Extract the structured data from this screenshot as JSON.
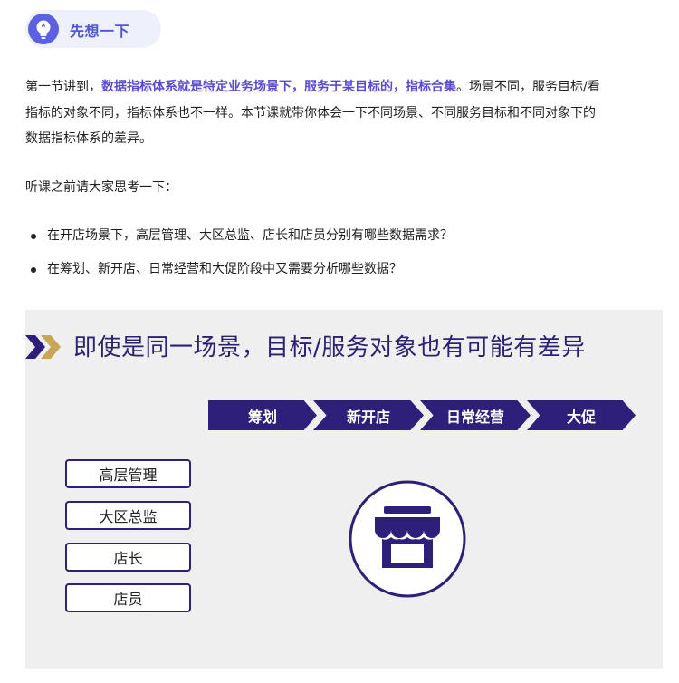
{
  "think": {
    "label": "先想一下",
    "icon": "bulb-icon"
  },
  "intro": {
    "line1_pre": "第一节讲到，",
    "line1_bold": "数据指标体系就是特定业务场景下，服务于某目标的，指标合集",
    "line1_post": "。场景不同，服务目标/看",
    "line2": "指标的对象不同，指标体系也不一样。本节课就带你体会一下不同场景、不同服务目标和不同对象下的",
    "line3": "数据指标体系的差异。"
  },
  "prompt": "听课之前请大家思考一下：",
  "questions": [
    "在开店场景下，高层管理、大区总监、店长和店员分别有哪些数据需求？",
    "在筹划、新开店、日常经营和大促阶段中又需要分析哪些数据？"
  ],
  "slide": {
    "title": "即使是同一场景，目标/服务对象也有可能有差异",
    "stages": [
      "筹划",
      "新开店",
      "日常经营",
      "大促"
    ],
    "roles": [
      "高层管理",
      "大区总监",
      "店长",
      "店员"
    ],
    "center_icon": "storefront-icon",
    "accent": "#2d1f7a",
    "arrow_gold": "#c9a55a"
  }
}
